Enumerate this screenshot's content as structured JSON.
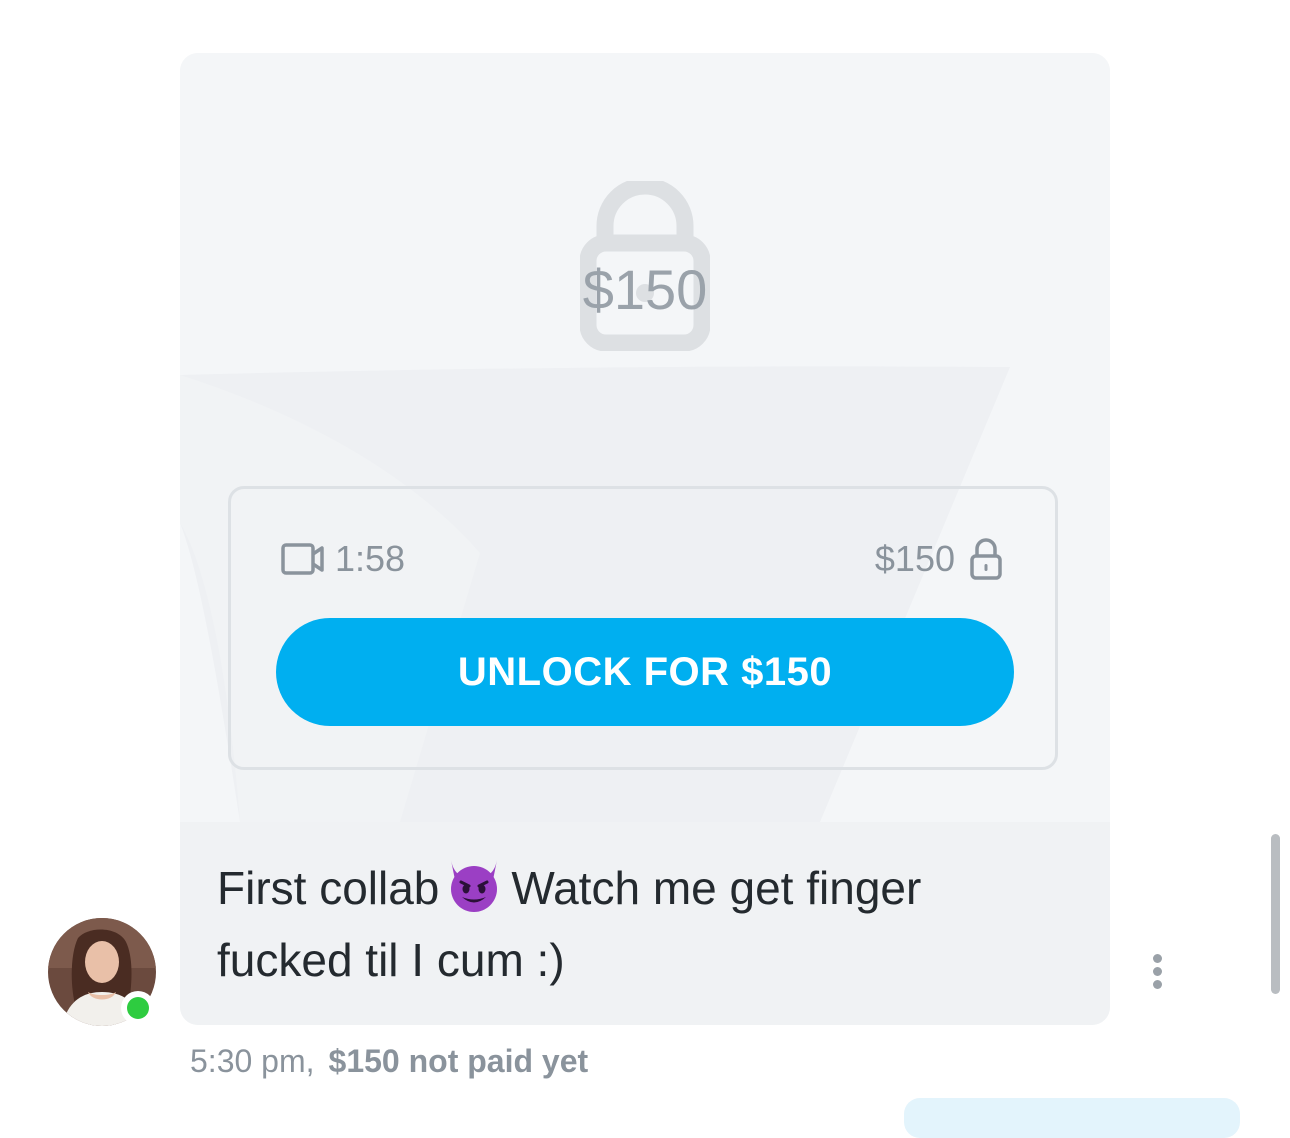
{
  "message": {
    "media": {
      "locked_price_overlay": "$150",
      "duration": "1:58",
      "price": "$150",
      "unlock_button_label": "UNLOCK FOR $150",
      "icons": {
        "big_lock": "padlock-icon",
        "video": "video-camera-icon",
        "small_lock": "padlock-icon"
      }
    },
    "text_part1": "First collab",
    "emoji": "smiling-face-with-horns-emoji",
    "text_part2": "Watch me get finger fucked til I cum :)",
    "time": "5:30 pm,",
    "payment_status": "$150 not paid yet"
  },
  "sender": {
    "online": true
  },
  "colors": {
    "accent": "#00aff0",
    "card_background": "#f4f6f8",
    "muted_text": "#8a939c",
    "online": "#2ecc40"
  }
}
